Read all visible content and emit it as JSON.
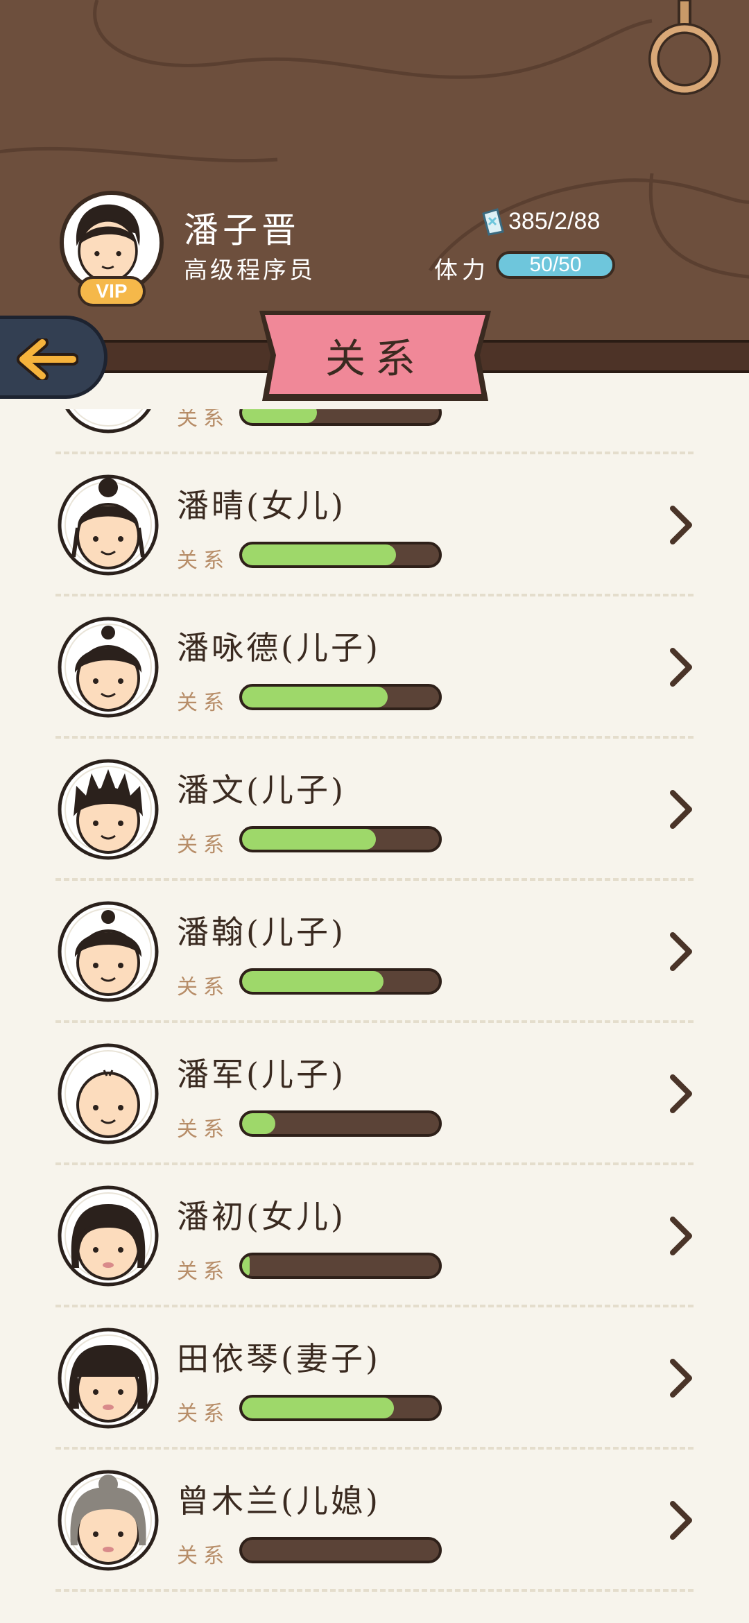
{
  "header": {
    "player_name": "潘子晋",
    "player_title": "高级程序员",
    "vip_label": "VIP",
    "money": "385/2/88",
    "stamina_label": "体力",
    "stamina_value": "50/50",
    "banner_title": "关系"
  },
  "relation_label": "关系",
  "members": [
    {
      "name": "",
      "relation_fill": 0.38,
      "face": "partial"
    },
    {
      "name": "潘晴(女儿)",
      "relation_fill": 0.78,
      "face": "girl-bun"
    },
    {
      "name": "潘咏德(儿子)",
      "relation_fill": 0.74,
      "face": "boy-bun"
    },
    {
      "name": "潘文(儿子)",
      "relation_fill": 0.68,
      "face": "boy-spiky"
    },
    {
      "name": "潘翰(儿子)",
      "relation_fill": 0.72,
      "face": "boy-bun"
    },
    {
      "name": "潘军(儿子)",
      "relation_fill": 0.17,
      "face": "bald"
    },
    {
      "name": "潘初(女儿)",
      "relation_fill": 0.04,
      "face": "girl-long"
    },
    {
      "name": "田依琴(妻子)",
      "relation_fill": 0.77,
      "face": "woman-bob"
    },
    {
      "name": "曾木兰(儿媳)",
      "relation_fill": 0.0,
      "face": "old-woman"
    }
  ],
  "colors": {
    "wood": "#6d4f3d",
    "banner": "#f08898",
    "bar_fill": "#9ed86a",
    "stamina": "#6ec6dc"
  }
}
